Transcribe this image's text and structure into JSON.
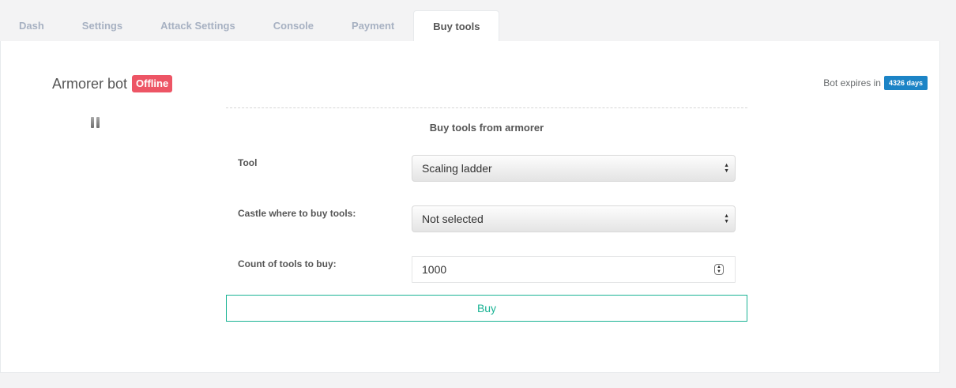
{
  "tabs": [
    {
      "label": "Dash",
      "active": false
    },
    {
      "label": "Settings",
      "active": false
    },
    {
      "label": "Attack Settings",
      "active": false
    },
    {
      "label": "Console",
      "active": false
    },
    {
      "label": "Payment",
      "active": false
    },
    {
      "label": "Buy tools",
      "active": true
    }
  ],
  "bot": {
    "name": "Armorer bot",
    "status": "Offline",
    "expires_label": "Bot expires in",
    "expires_value": "4326 days"
  },
  "form": {
    "title": "Buy tools from armorer",
    "tool_label": "Tool",
    "tool_value": "Scaling ladder",
    "castle_label": "Castle where to buy tools:",
    "castle_value": "Not selected",
    "count_label": "Count of tools to buy:",
    "count_value": "1000",
    "buy_label": "Buy"
  },
  "icons": {
    "pause": "pause-icon",
    "select_arrows": "updown-arrows-icon",
    "stepper": "stepper-icon"
  },
  "colors": {
    "offline_badge": "#ed5565",
    "days_badge": "#1c84c6",
    "buy_button": "#1ab394"
  }
}
